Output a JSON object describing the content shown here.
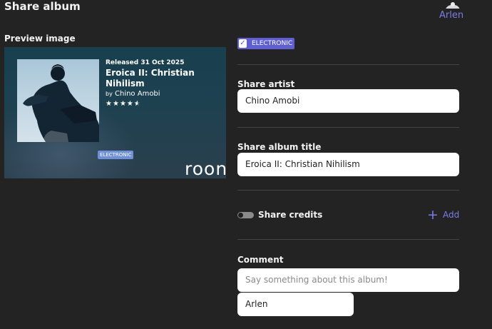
{
  "header": {
    "title": "Share album",
    "user_name": "Arlen"
  },
  "preview": {
    "label": "Preview image",
    "release_line": "Released 31 Oct 2025",
    "album_title": "Eroica II: Christian Nihilism",
    "by_prefix": "by",
    "artist": "Chino Amobi",
    "rating_stars": 4.5,
    "genre_pill": "ELECTRONIC",
    "brand": "roon"
  },
  "tags": {
    "items": [
      {
        "label": "ELECTRONIC",
        "checked": true
      }
    ]
  },
  "form": {
    "share_artist_label": "Share artist",
    "share_artist_value": "Chino Amobi",
    "share_title_label": "Share album title",
    "share_title_value": "Eroica II: Christian Nihilism",
    "share_credits_label": "Share credits",
    "share_credits_on": false,
    "add_label": "Add",
    "comment_label": "Comment",
    "comment_placeholder": "Say something about this album!",
    "author_value": "Arlen"
  },
  "icons": {
    "check": "check-icon",
    "add": "plus-icon",
    "star": "star-icon"
  },
  "colors": {
    "accent": "#5f5fd1",
    "link": "#7a7de8",
    "background": "#232323",
    "genre_pill": "#6f8fd8"
  }
}
